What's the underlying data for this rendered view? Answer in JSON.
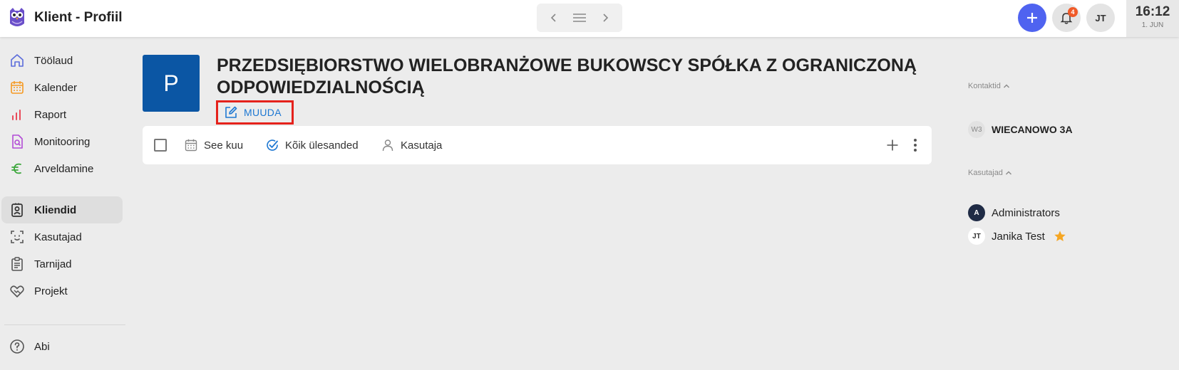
{
  "app": {
    "title": "Klient - Profiil"
  },
  "header": {
    "time": "16:12",
    "date": "1. JUN",
    "notifications_count": "4",
    "user_initials": "JT"
  },
  "sidebar": {
    "items": [
      {
        "label": "Töölaud",
        "icon": "home-icon",
        "color": "#5b6cdb"
      },
      {
        "label": "Kalender",
        "icon": "calendar-icon",
        "color": "#f59a23"
      },
      {
        "label": "Raport",
        "icon": "bar-chart-icon",
        "color": "#e94b5a"
      },
      {
        "label": "Monitooring",
        "icon": "monitor-doc-icon",
        "color": "#b24bd6"
      },
      {
        "label": "Arveldamine",
        "icon": "euro-icon",
        "color": "#3aa63a"
      },
      {
        "label": "Kliendid",
        "icon": "contact-card-icon",
        "color": "#333333",
        "active": true
      },
      {
        "label": "Kasutajad",
        "icon": "face-scan-icon",
        "color": "#555555"
      },
      {
        "label": "Tarnijad",
        "icon": "clipboard-icon",
        "color": "#555555"
      },
      {
        "label": "Projekt",
        "icon": "handshake-icon",
        "color": "#555555"
      },
      {
        "label": "Abi",
        "icon": "help-icon",
        "color": "#555555"
      }
    ]
  },
  "client": {
    "avatar_letter": "P",
    "name": "PRZEDSIĘBIORSTWO WIELOBRANŻOWE BUKOWSCY SPÓŁKA Z OGRANICZONĄ ODPOWIEDZIALNOŚCIĄ",
    "edit_label": "MUUDA",
    "avatar_color": "#0b56a4"
  },
  "toolbar": {
    "filters": [
      {
        "label": "See kuu",
        "icon": "calendar-icon"
      },
      {
        "label": "Kõik ülesanded",
        "icon": "check-circle-icon"
      },
      {
        "label": "Kasutaja",
        "icon": "user-icon"
      }
    ]
  },
  "right_panel": {
    "contacts_heading": "Kontaktid",
    "contacts": [
      {
        "badge": "W3",
        "label": "WIECANOWO 3A"
      }
    ],
    "users_heading": "Kasutajad",
    "users": [
      {
        "badge": "A",
        "label": "Administrators"
      },
      {
        "badge": "JT",
        "label": "Janika Test",
        "starred": true
      }
    ]
  },
  "colors": {
    "accent": "#4f63f0",
    "link": "#1e78d2",
    "highlight_border": "#e5221c",
    "star": "#f5a623"
  }
}
